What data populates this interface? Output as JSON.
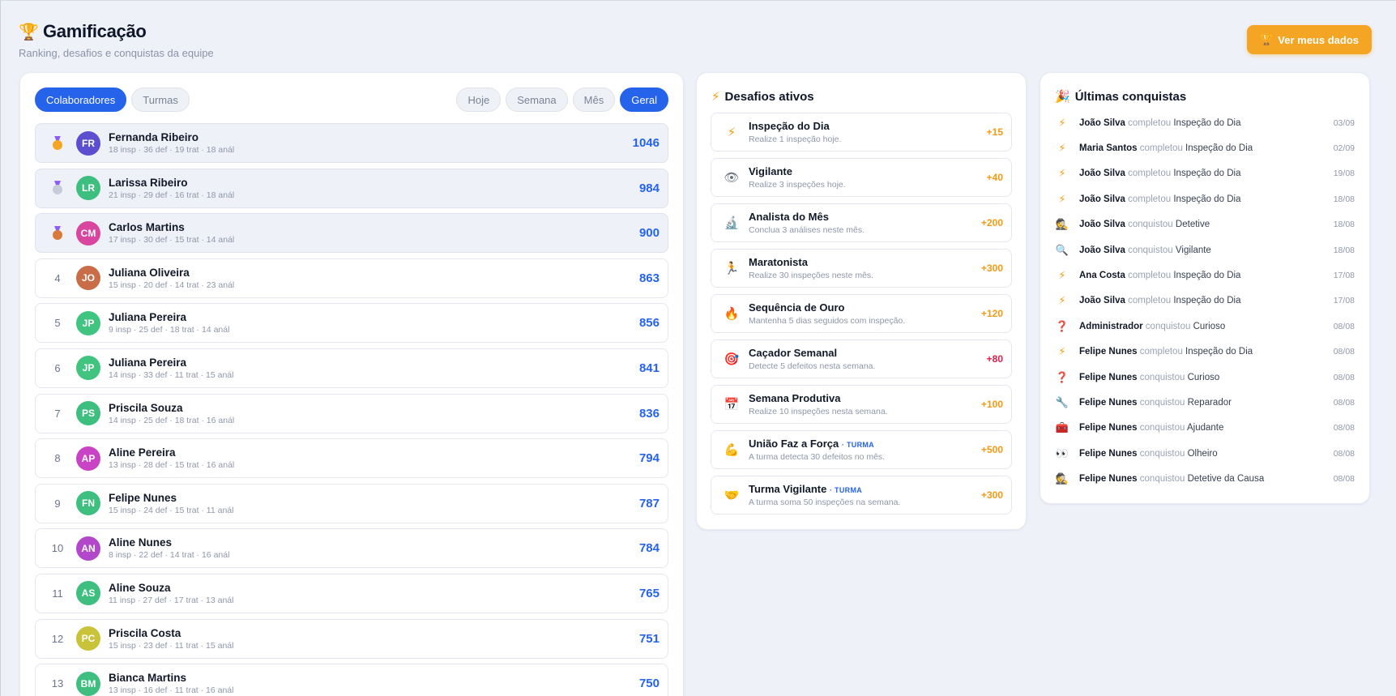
{
  "header": {
    "title": "Gamificação",
    "subtitle": "Ranking, desafios e conquistas da equipe",
    "cta_label": "Ver meus dados"
  },
  "ranking": {
    "scope_tabs": [
      {
        "label": "Colaboradores",
        "active": true
      },
      {
        "label": "Turmas",
        "active": false
      }
    ],
    "period_tabs": [
      {
        "label": "Hoje",
        "active": false
      },
      {
        "label": "Semana",
        "active": false
      },
      {
        "label": "Mês",
        "active": false
      },
      {
        "label": "Geral",
        "active": true
      }
    ],
    "rows": [
      {
        "pos": "1",
        "initials": "FR",
        "name": "Fernanda Ribeiro",
        "stats": "18 insp · 36 def · 19 trat · 18 anál",
        "points": "1046",
        "color": "#5b4fcf",
        "medal": "#f5a524"
      },
      {
        "pos": "2",
        "initials": "LR",
        "name": "Larissa Ribeiro",
        "stats": "21 insp · 29 def · 16 trat · 18 anál",
        "points": "984",
        "color": "#3fbf7f",
        "medal": "#c7ccd8"
      },
      {
        "pos": "3",
        "initials": "CM",
        "name": "Carlos Martins",
        "stats": "17 insp · 30 def · 15 trat · 14 anál",
        "points": "900",
        "color": "#d946a0",
        "medal": "#d97a3a"
      },
      {
        "pos": "4",
        "initials": "JO",
        "name": "Juliana Oliveira",
        "stats": "15 insp · 20 def · 14 trat · 23 anál",
        "points": "863",
        "color": "#c86d47"
      },
      {
        "pos": "5",
        "initials": "JP",
        "name": "Juliana Pereira",
        "stats": "9 insp · 25 def · 18 trat · 14 anál",
        "points": "856",
        "color": "#40c47f"
      },
      {
        "pos": "6",
        "initials": "JP",
        "name": "Juliana Pereira",
        "stats": "14 insp · 33 def · 11 trat · 15 anál",
        "points": "841",
        "color": "#40c47f"
      },
      {
        "pos": "7",
        "initials": "PS",
        "name": "Priscila Souza",
        "stats": "14 insp · 25 def · 18 trat · 16 anál",
        "points": "836",
        "color": "#3fbf7f"
      },
      {
        "pos": "8",
        "initials": "AP",
        "name": "Aline Pereira",
        "stats": "13 insp · 28 def · 15 trat · 16 anál",
        "points": "794",
        "color": "#c944c5"
      },
      {
        "pos": "9",
        "initials": "FN",
        "name": "Felipe Nunes",
        "stats": "15 insp · 24 def · 15 trat · 11 anál",
        "points": "787",
        "color": "#3fbf7f"
      },
      {
        "pos": "10",
        "initials": "AN",
        "name": "Aline Nunes",
        "stats": "8 insp · 22 def · 14 trat · 16 anál",
        "points": "784",
        "color": "#b247c9"
      },
      {
        "pos": "11",
        "initials": "AS",
        "name": "Aline Souza",
        "stats": "11 insp · 27 def · 17 trat · 13 anál",
        "points": "765",
        "color": "#3fbf7f"
      },
      {
        "pos": "12",
        "initials": "PC",
        "name": "Priscila Costa",
        "stats": "15 insp · 23 def · 11 trat · 15 anál",
        "points": "751",
        "color": "#c9c33a"
      },
      {
        "pos": "13",
        "initials": "BM",
        "name": "Bianca Martins",
        "stats": "13 insp · 16 def · 11 trat · 16 anál",
        "points": "750",
        "color": "#3fbf7f"
      }
    ]
  },
  "challenges": {
    "title": "Desafios ativos",
    "items": [
      {
        "icon": "bolt-icon",
        "glyph": "⚡",
        "cls": "bolt",
        "name": "Inspeção do Dia",
        "tag": "",
        "desc": "Realize 1 inspeção hoje.",
        "points": "+15",
        "red": false
      },
      {
        "icon": "eye-icon",
        "glyph": "👁",
        "cls": "g-gray",
        "name": "Vigilante",
        "tag": "",
        "desc": "Realize 3 inspeções hoje.",
        "points": "+40",
        "red": false
      },
      {
        "icon": "microscope-icon",
        "glyph": "🔬",
        "cls": "g-blue",
        "name": "Analista do Mês",
        "tag": "",
        "desc": "Conclua 3 análises neste mês.",
        "points": "+200",
        "red": false
      },
      {
        "icon": "runner-icon",
        "glyph": "🏃",
        "cls": "g-orange",
        "name": "Maratonista",
        "tag": "",
        "desc": "Realize 30 inspeções neste mês.",
        "points": "+300",
        "red": false
      },
      {
        "icon": "fire-icon",
        "glyph": "🔥",
        "cls": "g-orange",
        "name": "Sequência de Ouro",
        "tag": "",
        "desc": "Mantenha 5 dias seguidos com inspeção.",
        "points": "+120",
        "red": false
      },
      {
        "icon": "target-icon",
        "glyph": "🎯",
        "cls": "g-red",
        "name": "Caçador Semanal",
        "tag": "",
        "desc": "Detecte 5 defeitos nesta semana.",
        "points": "+80",
        "red": true
      },
      {
        "icon": "calendar-icon",
        "glyph": "📅",
        "cls": "g-purple",
        "name": "Semana Produtiva",
        "tag": "",
        "desc": "Realize 10 inspeções nesta semana.",
        "points": "+100",
        "red": false
      },
      {
        "icon": "muscle-icon",
        "glyph": "💪",
        "cls": "g-yellow",
        "name": "União Faz a Força",
        "tag": "· TURMA",
        "desc": "A turma detecta 30 defeitos no mês.",
        "points": "+500",
        "red": false
      },
      {
        "icon": "handshake-icon",
        "glyph": "🤝",
        "cls": "g-yellow",
        "name": "Turma Vigilante",
        "tag": "· TURMA",
        "desc": "A turma soma 50 inspeções na semana.",
        "points": "+300",
        "red": false
      }
    ]
  },
  "achievements": {
    "title": "Últimas conquistas",
    "items": [
      {
        "icon": "bolt-icon",
        "glyph": "⚡",
        "cls": "bolt",
        "who": "João Silva",
        "verb": "completou",
        "what": "Inspeção do Dia",
        "date": "03/09"
      },
      {
        "icon": "bolt-icon",
        "glyph": "⚡",
        "cls": "bolt",
        "who": "Maria Santos",
        "verb": "completou",
        "what": "Inspeção do Dia",
        "date": "02/09"
      },
      {
        "icon": "bolt-icon",
        "glyph": "⚡",
        "cls": "bolt",
        "who": "João Silva",
        "verb": "completou",
        "what": "Inspeção do Dia",
        "date": "19/08"
      },
      {
        "icon": "bolt-icon",
        "glyph": "⚡",
        "cls": "bolt",
        "who": "João Silva",
        "verb": "completou",
        "what": "Inspeção do Dia",
        "date": "18/08"
      },
      {
        "icon": "detective-icon",
        "glyph": "🕵",
        "cls": "g-purple",
        "who": "João Silva",
        "verb": "conquistou",
        "what": "Detetive",
        "date": "18/08"
      },
      {
        "icon": "magnifier-icon",
        "glyph": "🔍",
        "cls": "g-blue",
        "who": "João Silva",
        "verb": "conquistou",
        "what": "Vigilante",
        "date": "18/08"
      },
      {
        "icon": "bolt-icon",
        "glyph": "⚡",
        "cls": "bolt",
        "who": "Ana Costa",
        "verb": "completou",
        "what": "Inspeção do Dia",
        "date": "17/08"
      },
      {
        "icon": "bolt-icon",
        "glyph": "⚡",
        "cls": "bolt",
        "who": "João Silva",
        "verb": "completou",
        "what": "Inspeção do Dia",
        "date": "17/08"
      },
      {
        "icon": "question-icon",
        "glyph": "❓",
        "cls": "g-red",
        "who": "Administrador",
        "verb": "conquistou",
        "what": "Curioso",
        "date": "08/08"
      },
      {
        "icon": "bolt-icon",
        "glyph": "⚡",
        "cls": "bolt",
        "who": "Felipe Nunes",
        "verb": "completou",
        "what": "Inspeção do Dia",
        "date": "08/08"
      },
      {
        "icon": "question-icon",
        "glyph": "❓",
        "cls": "g-red",
        "who": "Felipe Nunes",
        "verb": "conquistou",
        "what": "Curioso",
        "date": "08/08"
      },
      {
        "icon": "wrench-icon",
        "glyph": "🔧",
        "cls": "g-gray",
        "who": "Felipe Nunes",
        "verb": "conquistou",
        "what": "Reparador",
        "date": "08/08"
      },
      {
        "icon": "toolbox-icon",
        "glyph": "🧰",
        "cls": "g-red",
        "who": "Felipe Nunes",
        "verb": "conquistou",
        "what": "Ajudante",
        "date": "08/08"
      },
      {
        "icon": "eyes-icon",
        "glyph": "👀",
        "cls": "g-gray",
        "who": "Felipe Nunes",
        "verb": "conquistou",
        "what": "Olheiro",
        "date": "08/08"
      },
      {
        "icon": "detective-icon",
        "glyph": "🕵",
        "cls": "g-purple",
        "who": "Felipe Nunes",
        "verb": "conquistou",
        "what": "Detetive da Causa",
        "date": "08/08"
      }
    ]
  }
}
